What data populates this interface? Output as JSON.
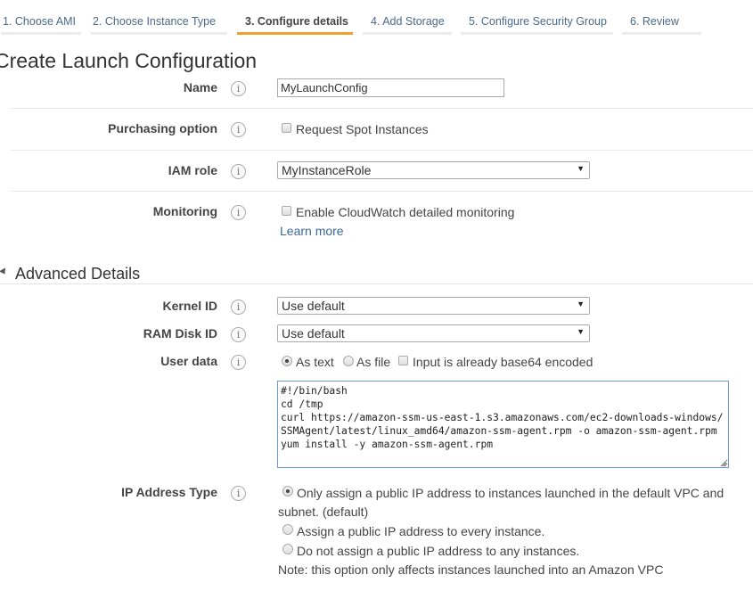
{
  "wizard": {
    "steps": [
      {
        "label": "1. Choose AMI",
        "active": false
      },
      {
        "label": "2. Choose Instance Type",
        "active": false
      },
      {
        "label": "3. Configure details",
        "active": true
      },
      {
        "label": "4. Add Storage",
        "active": false
      },
      {
        "label": "5. Configure Security Group",
        "active": false
      },
      {
        "label": "6. Review",
        "active": false
      }
    ],
    "active_color": "#f0a030"
  },
  "page": {
    "title": "Create Launch Configuration"
  },
  "form": {
    "name": {
      "label": "Name",
      "value": "MyLaunchConfig"
    },
    "purchasing": {
      "label": "Purchasing option",
      "checkbox_label": "Request Spot Instances",
      "checked": false
    },
    "iam_role": {
      "label": "IAM role",
      "value": "MyInstanceRole"
    },
    "monitoring": {
      "label": "Monitoring",
      "checkbox_label": "Enable CloudWatch detailed monitoring",
      "checked": false,
      "learn_more": "Learn more"
    }
  },
  "advanced": {
    "heading": "Advanced Details",
    "kernel_id": {
      "label": "Kernel ID",
      "value": "Use default"
    },
    "ram_disk_id": {
      "label": "RAM Disk ID",
      "value": "Use default"
    },
    "user_data": {
      "label": "User data",
      "as_text": "As text",
      "as_file": "As file",
      "base64_label": "Input is already base64 encoded",
      "selected": "As text",
      "base64_checked": false,
      "content": "#!/bin/bash\ncd /tmp\ncurl https://amazon-ssm-us-east-1.s3.amazonaws.com/ec2-downloads-windows/SSMAgent/latest/linux_amd64/amazon-ssm-agent.rpm -o amazon-ssm-agent.rpm\nyum install -y amazon-ssm-agent.rpm"
    },
    "ip_address_type": {
      "label": "IP Address Type",
      "options": [
        {
          "label": "Only assign a public IP address to instances launched in the default VPC and",
          "label_cont": "subnet. (default)",
          "selected": true
        },
        {
          "label": "Assign a public IP address to every instance.",
          "selected": false
        },
        {
          "label": "Do not assign a public IP address to any instances.",
          "selected": false
        }
      ],
      "note": "Note: this option only affects instances launched into an Amazon VPC"
    }
  },
  "icons": {
    "info": "i",
    "select_arrow": "▼",
    "resize_grip": "◢"
  }
}
